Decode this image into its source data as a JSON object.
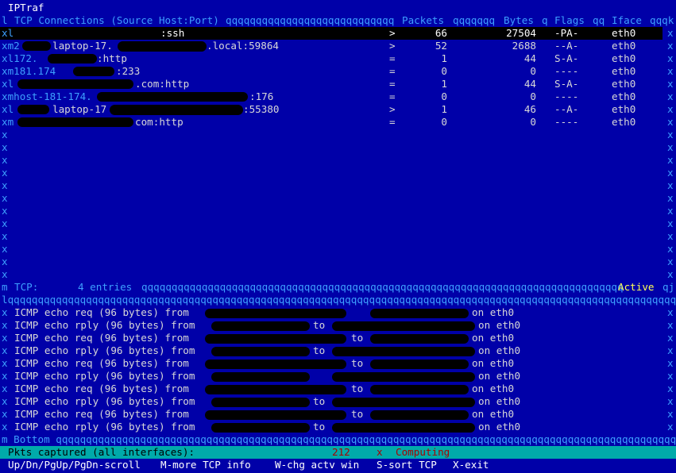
{
  "app": {
    "title": "IPTraf"
  },
  "tcp_window": {
    "header": {
      "corner": "l",
      "title": "TCP Connections (Source Host:Port)",
      "fill1": "qqqqqqqqqqqqqqqqqqqqqqqqqqqq",
      "packets": "Packets",
      "fill2": "qqqqqqq",
      "bytes": "Bytes",
      "fill3": "q",
      "flags": "Flags",
      "fill4": "qq",
      "iface": "Iface",
      "tail": "qqqk"
    },
    "connections": [
      {
        "marker": "xl",
        "host": ":ssh",
        "dir": ">",
        "packets": "66",
        "bytes": "27504",
        "flags": "-PA-",
        "iface": "eth0",
        "selected": true
      },
      {
        "marker": "xm2",
        "host": "laptop-17.",
        "host2": ".local:59864",
        "dir": ">",
        "packets": "52",
        "bytes": "2688",
        "flags": "--A-",
        "iface": "eth0"
      },
      {
        "marker": "xl172.",
        "host": ":http",
        "dir": "=",
        "packets": "1",
        "bytes": "44",
        "flags": "S-A-",
        "iface": "eth0"
      },
      {
        "marker": "xm181.174",
        "host": ":233",
        "dir": "=",
        "packets": "0",
        "bytes": "0",
        "flags": "----",
        "iface": "eth0"
      },
      {
        "marker": "xl",
        "host": ".com:http",
        "dir": "=",
        "packets": "1",
        "bytes": "44",
        "flags": "S-A-",
        "iface": "eth0"
      },
      {
        "marker": "xmhost-181-174.",
        "host": ":176",
        "dir": "=",
        "packets": "0",
        "bytes": "0",
        "flags": "----",
        "iface": "eth0"
      },
      {
        "marker": "xl",
        "host": "laptop-17",
        "host2": ":55380",
        "dir": ">",
        "packets": "1",
        "bytes": "46",
        "flags": "--A-",
        "iface": "eth0"
      },
      {
        "marker": "xm",
        "host": "com:http",
        "dir": "=",
        "packets": "0",
        "bytes": "0",
        "flags": "----",
        "iface": "eth0"
      }
    ],
    "right_border": "x",
    "empty_row_marker": "x",
    "footer": {
      "corner": "m",
      "label": "TCP:",
      "entries": "4 entries",
      "fill": "qqqqqqqqqqqqqqqqqqqqqqqqqqqqqqqqqqqqqqqqqqqqqqqqqqqqqqqqqqqqqqqqqqqqqqqqqqqqqqqq",
      "active": "Active",
      "tail": "qj"
    }
  },
  "other_window": {
    "top_border": "lqqqqqqqqqqqqqqqqqqqqqqqqqqqqqqqqqqqqqqqqqqqqqqqqqqqqqqqqqqqqqqqqqqqqqqqqqqqqqqqqqqqqqqqqqqqqqqqqqqqqqqqqqqqqqqqqqqqqqqqqqqqqqqqqqqqqqqqk",
    "lines": [
      {
        "text": "ICMP echo req (96 bytes) from",
        "to": "",
        "iface": "on eth0"
      },
      {
        "text": "ICMP echo rply (96 bytes) from",
        "to": "to",
        "iface": "on eth0"
      },
      {
        "text": "ICMP echo req (96 bytes) from",
        "to": "to",
        "iface": "on eth0"
      },
      {
        "text": "ICMP echo rply (96 bytes) from",
        "to": "to",
        "iface": "on eth0"
      },
      {
        "text": "ICMP echo req (96 bytes) from",
        "to": "to",
        "iface": "on eth0"
      },
      {
        "text": "ICMP echo rply (96 bytes) from",
        "to": "",
        "iface": "on eth0"
      },
      {
        "text": "ICMP echo req (96 bytes) from",
        "to": "to",
        "iface": "on eth0"
      },
      {
        "text": "ICMP echo rply (96 bytes) from",
        "to": "to",
        "iface": "on eth0"
      },
      {
        "text": "ICMP echo req (96 bytes) from",
        "to": "to",
        "iface": "on eth0"
      },
      {
        "text": "ICMP echo rply (96 bytes) from",
        "to": "to",
        "iface": "on eth0"
      }
    ],
    "bottom_border": "m Bottom qqqqqqqqqqqqqqqqqqqqqqqqqqqqqqqqqqqqqqqqqqqqqqqqqqqqqqqqqqqqqqqqqqqqqqqqqqqqqqqqqqqqqqqqqqqqqqqqqqqqqqqqqqqqqqqqqqqqqqqqqqqqqqqqqqqqj"
  },
  "status": {
    "label": "Pkts captured (all interfaces):",
    "count": "212",
    "sep": "x",
    "state": "Computing"
  },
  "hints": {
    "scroll": "Up/Dn/PgUp/PgDn-scroll",
    "more": "M-more TCP info",
    "chg": "W-chg actv win",
    "sort": "S-sort TCP",
    "exit": "X-exit"
  },
  "colors": {
    "background": "#0000a8",
    "border": "#3ea0ff",
    "status_bar": "#00aaaa",
    "count": "#aa0000",
    "active": "#ffff55"
  }
}
